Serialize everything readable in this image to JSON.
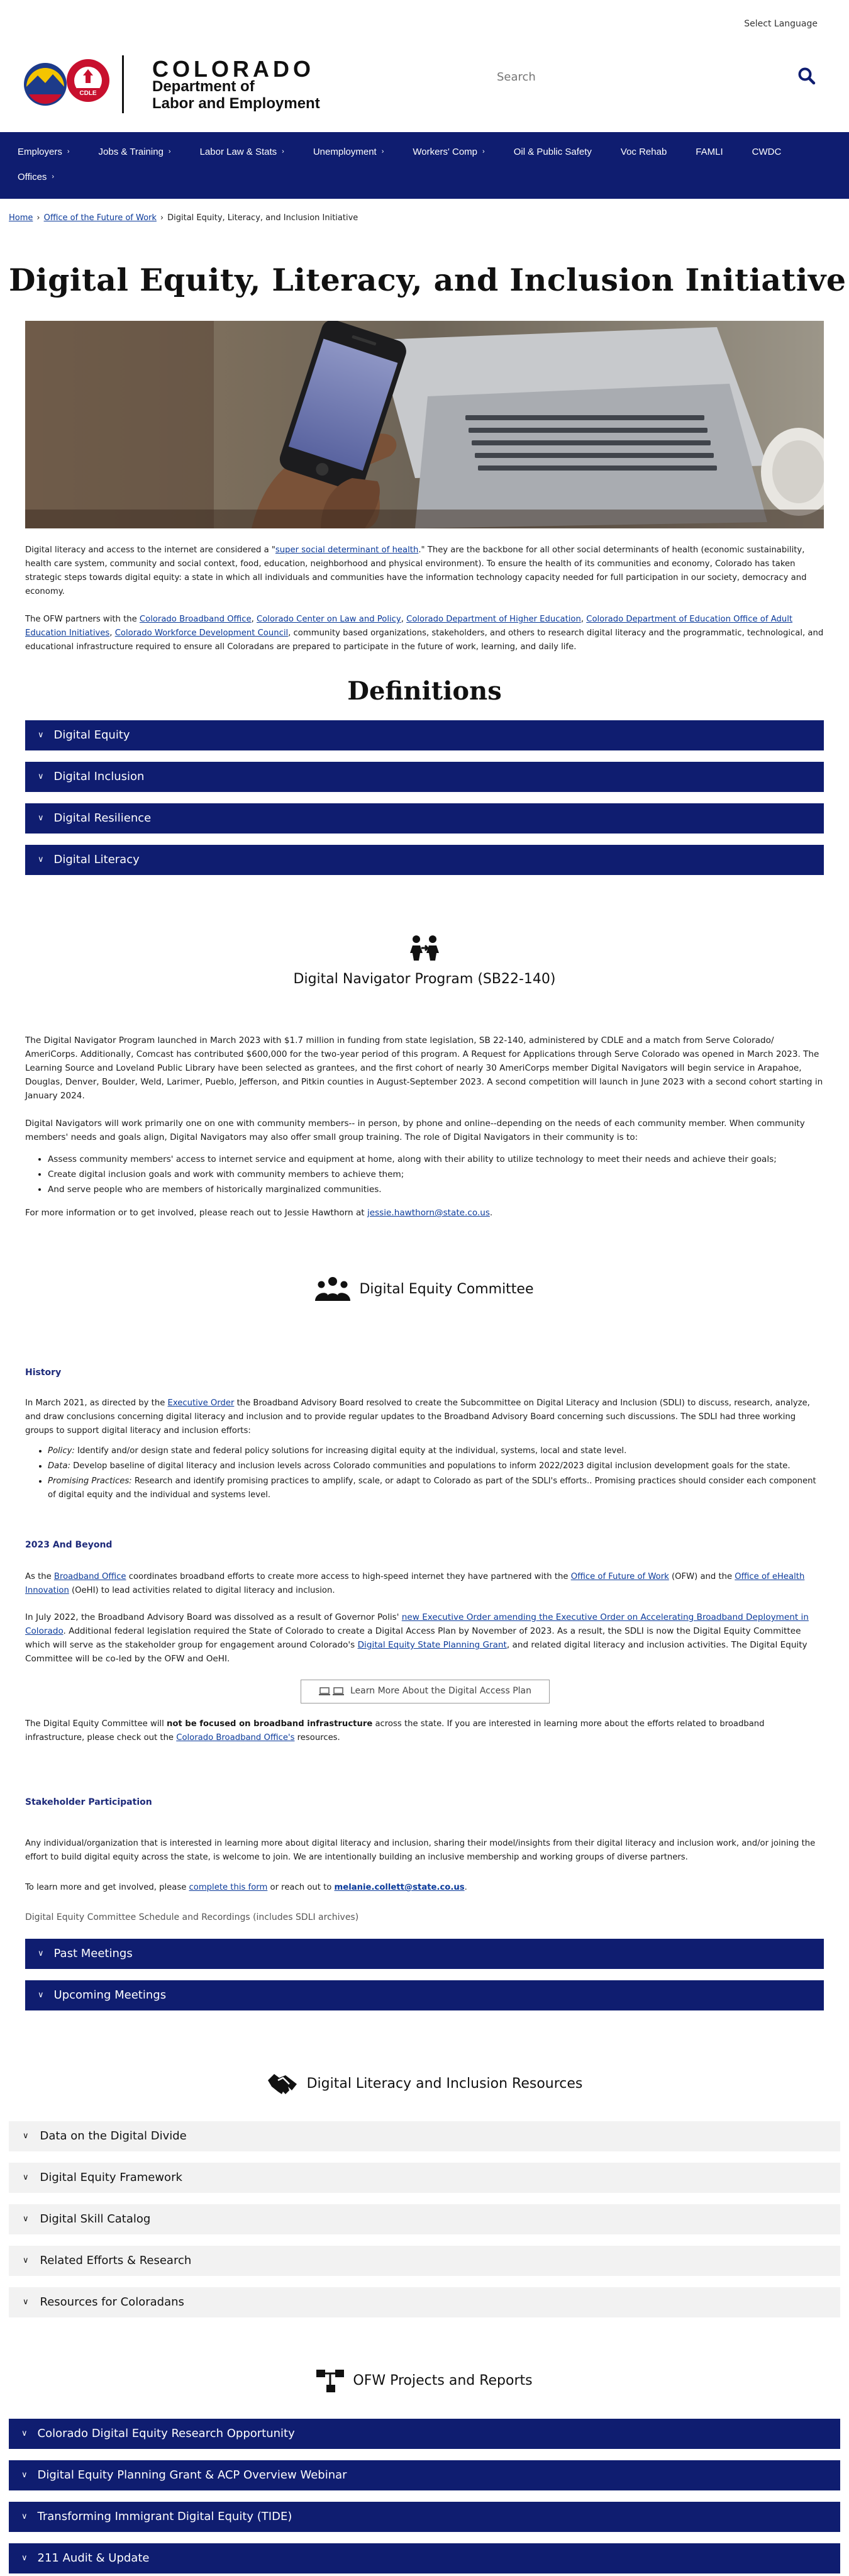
{
  "header": {
    "select_language": "Select Language",
    "logo_word": "COLORADO",
    "logo_dept_line1": "Department of",
    "logo_dept_line2": "Labor and Employment",
    "logo_badge": "CDLE",
    "search_placeholder": "Search"
  },
  "nav": {
    "row1": [
      {
        "label": "Employers",
        "chevron": true
      },
      {
        "label": "Jobs & Training",
        "chevron": true
      },
      {
        "label": "Labor Law & Stats",
        "chevron": true
      },
      {
        "label": "Unemployment",
        "chevron": true
      },
      {
        "label": "Workers' Comp",
        "chevron": true
      },
      {
        "label": "Oil & Public Safety",
        "chevron": false
      },
      {
        "label": "Voc Rehab",
        "chevron": false
      },
      {
        "label": "FAMLI",
        "chevron": false
      },
      {
        "label": "CWDC",
        "chevron": false
      }
    ],
    "row2": [
      {
        "label": "Offices",
        "chevron": true
      }
    ]
  },
  "breadcrumb": {
    "home": "Home",
    "sep": "›",
    "parent": "Office of the Future of Work",
    "current": "Digital Equity, Literacy, and Inclusion Initiative"
  },
  "page_title": "Digital Equity, Literacy, and Inclusion Initiative",
  "intro": {
    "p1_a": "Digital literacy and access to the internet are considered a \"",
    "p1_link": "super social determinant of health",
    "p1_b": ".\" They are the backbone  for all other social determinants of health (economic sustainability, health care system, community and social context, food, education, neighborhood and physical environment). To ensure the health of its communities and economy, Colorado has taken strategic steps towards digital equity: a state in which all individuals and communities have the information technology capacity needed for full participation in our society, democracy and economy.",
    "p2_a": "The OFW partners with the ",
    "p2_l1": "Colorado Broadband Office",
    "p2_l2": "Colorado Center on Law and Policy",
    "p2_l3": "Colorado Department of Higher Education",
    "p2_l4": "Colorado Department of Education Office of Adult Education Initiatives",
    "p2_l5": "Colorado Workforce Development Council",
    "p2_b": ", community based organizations, stakeholders, and others to research digital literacy and the programmatic, technological, and educational infrastructure required to ensure all Coloradans are prepared to participate in the future of work, learning, and daily life.",
    "comma": ", "
  },
  "definitions": {
    "title": "Definitions",
    "items": [
      "Digital Equity",
      "Digital Inclusion",
      "Digital Resilience",
      "Digital Literacy"
    ]
  },
  "navigator": {
    "title": "Digital Navigator Program (SB22-140)",
    "p1": "The Digital Navigator Program launched in March 2023 with $1.7 million in funding from state legislation, SB 22-140, administered by CDLE and a match from Serve Colorado/ AmeriCorps. Additionally, Comcast has contributed $600,000 for the two-year period of this program. A Request for Applications through Serve Colorado was opened in March 2023. The Learning Source and Loveland Public Library have been selected as grantees, and the first cohort of nearly 30 AmeriCorps member Digital Navigators will begin service in Arapahoe, Douglas, Denver, Boulder, Weld, Larimer, Pueblo, Jefferson, and Pitkin counties in August-September 2023. A second competition will launch in June 2023 with a second cohort starting in January 2024.",
    "p2": "Digital Navigators will work primarily one on one with community members-- in person, by phone and online--depending on the needs of each community member. When community members' needs and goals align, Digital Navigators may also offer small group training.  The role of Digital Navigators in their community is to:",
    "bullets": [
      "Assess community members' access to internet service and equipment at home, along with their ability to utilize technology to meet their needs and achieve their goals;",
      "Create digital inclusion goals and work with community members to achieve them;",
      "And serve people who are members of historically marginalized communities."
    ],
    "p3_a": "For more information or to get involved, please reach out to Jessie Hawthorn at ",
    "p3_link": "jessie.hawthorn@state.co.us",
    "p3_b": "."
  },
  "committee": {
    "title": "Digital Equity Committee",
    "history_h": "History",
    "history_p_a": "In March 2021, as directed by the ",
    "history_p_link": "Executive Order",
    "history_p_b": " the Broadband Advisory Board resolved to create the Subcommittee on Digital Literacy and Inclusion (SDLI) to discuss, research, analyze, and draw conclusions concerning digital literacy and inclusion and to provide regular updates to the Broadband Advisory Board concerning such discussions. The SDLI had three working groups to support digital literacy and inclusion efforts:",
    "groups": [
      {
        "label": "Policy:",
        "text": " Identify and/or design state and federal policy solutions for increasing digital equity at the individual, systems, local and state level."
      },
      {
        "label": "Data:",
        "text": " Develop baseline of digital literacy and inclusion levels across Colorado communities and populations to inform 2022/2023 digital inclusion development goals for the state."
      },
      {
        "label": "Promising Practices:",
        "text": " Research and identify promising practices to amplify, scale, or adapt to Colorado as part of the SDLI's efforts.. Promising practices should consider each component of digital equity and the individual and systems level."
      }
    ],
    "beyond_h": "2023 And Beyond",
    "beyond_p1_a": "As the ",
    "beyond_p1_l1": "Broadband Office",
    "beyond_p1_b": " coordinates broadband efforts to create more access to high-speed internet they have partnered with the ",
    "beyond_p1_l2": "Office of Future of Work",
    "beyond_p1_c": " (OFW) and the ",
    "beyond_p1_l3": "Office of eHealth Innovation",
    "beyond_p1_d": " (OeHI) to lead activities related to digital literacy and inclusion.",
    "beyond_p2_a": "In July 2022, the Broadband Advisory Board was dissolved as a result of Governor Polis' ",
    "beyond_p2_l1": "new Executive Order amending the Executive Order on Accelerating Broadband Deployment in Colorado",
    "beyond_p2_b": ". Additional federal legislation required the State of Colorado to create a Digital Access Plan by November of 2023. As a result, the SDLI is now the Digital Equity Committee which will serve as the stakeholder group for engagement around Colorado's ",
    "beyond_p2_l2": "Digital Equity State Planning Grant",
    "beyond_p2_c": ", and related digital literacy and inclusion activities. The Digital Equity Committee will be co-led by the OFW and OeHI.",
    "plan_button": "Learn More About the Digital Access Plan",
    "focus_p_a": "The Digital Equity Committee will ",
    "focus_p_bold": "not be focused on broadband infrastructure",
    "focus_p_b": " across the state. If you are interested in learning more about the efforts related to broadband infrastructure, please check out the ",
    "focus_p_link": "Colorado Broadband Office's",
    "focus_p_c": " resources.",
    "stake_h": "Stakeholder Participation",
    "stake_p": "Any individual/organization that is interested in learning more about digital literacy and inclusion, sharing their model/insights from their digital literacy and inclusion work, and/or joining the effort to build digital equity across the state, is welcome to join. We are intentionally building an inclusive membership and working groups of diverse partners.",
    "contact_a": "To learn more and get involved, please ",
    "contact_l1": "complete this form",
    "contact_b": " or reach out to ",
    "contact_l2": "melanie.collett@state.co.us",
    "contact_c": ".",
    "schedule": "Digital Equity Committee Schedule and Recordings (includes SDLI archives)",
    "meetings": [
      "Past Meetings",
      "Upcoming Meetings"
    ]
  },
  "resources": {
    "title": "Digital Literacy and Inclusion Resources",
    "items": [
      "Data on the Digital Divide",
      "Digital Equity Framework",
      "Digital Skill Catalog",
      "Related Efforts & Research",
      "Resources for Coloradans"
    ]
  },
  "projects": {
    "title": "OFW Projects and Reports",
    "items": [
      "Colorado Digital Equity Research Opportunity",
      "Digital Equity Planning Grant & ACP Overview Webinar",
      "Transforming Immigrant Digital Equity (TIDE)",
      "211 Audit & Update"
    ]
  },
  "colors": {
    "nav_blue": "#0f1d70",
    "link_blue": "#0b3a9a",
    "accordion_light": "#f2f2f2",
    "colorado_red": "#c8102e",
    "colorado_gold": "#f4c400"
  },
  "icons": {
    "search": "magnifier-icon",
    "navigator": "people-connect-icon",
    "committee": "group-icon",
    "resources": "handshake-icon",
    "projects": "hierarchy-icon",
    "chevron": "chevron-down-icon"
  }
}
